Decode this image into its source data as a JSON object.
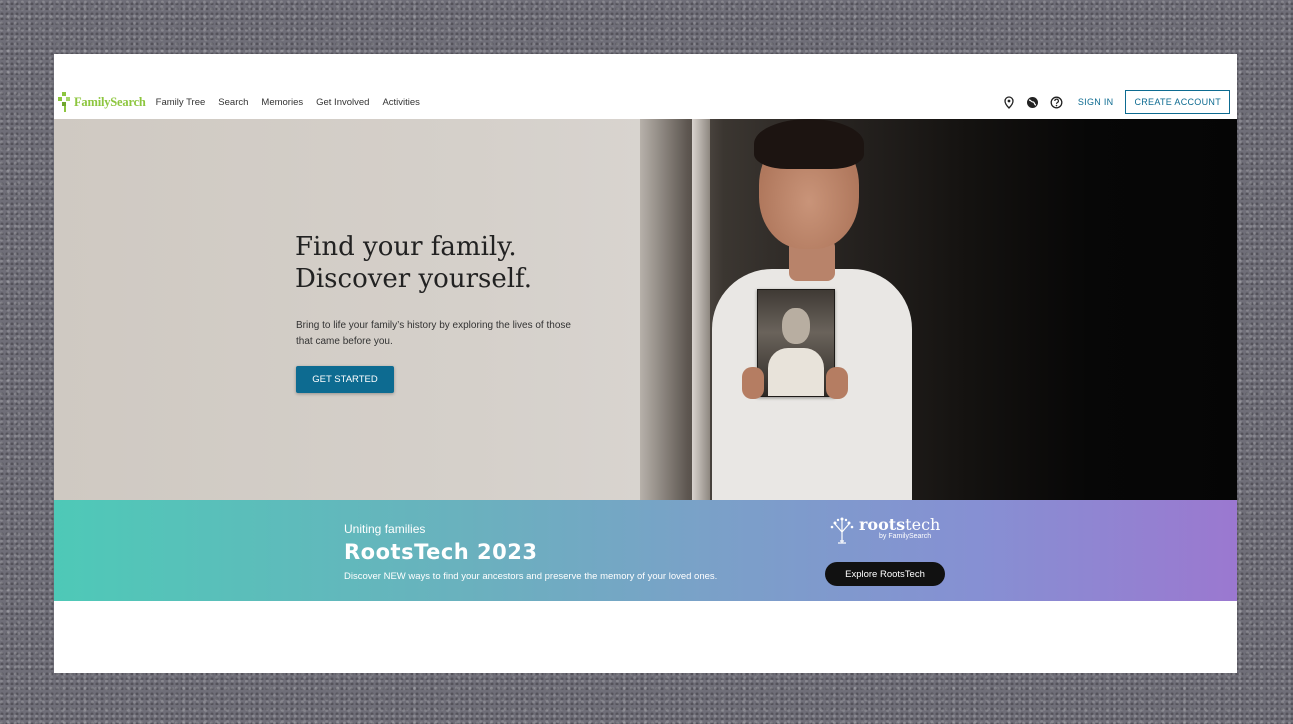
{
  "brand": {
    "name": "FamilySearch",
    "color": "#8dc63f"
  },
  "nav": {
    "links": [
      "Family Tree",
      "Search",
      "Memories",
      "Get Involved",
      "Activities"
    ],
    "icons": [
      "location-pin-icon",
      "globe-icon",
      "help-icon"
    ],
    "sign_in": "SIGN IN",
    "create_account": "CREATE ACCOUNT"
  },
  "hero": {
    "title_line1": "Find your family.",
    "title_line2": "Discover yourself.",
    "description": "Bring to life your family’s history by exploring the lives of those that came before you.",
    "cta": "GET STARTED",
    "accent": "#0d6b91"
  },
  "banner": {
    "subtitle": "Uniting families",
    "title": "RootsTech 2023",
    "description": "Discover NEW ways to find your ancestors and preserve the memory of your loved ones.",
    "logo_roots": "roots",
    "logo_tech": "tech",
    "logo_by": "by FamilySearch",
    "cta": "Explore RootsTech"
  }
}
